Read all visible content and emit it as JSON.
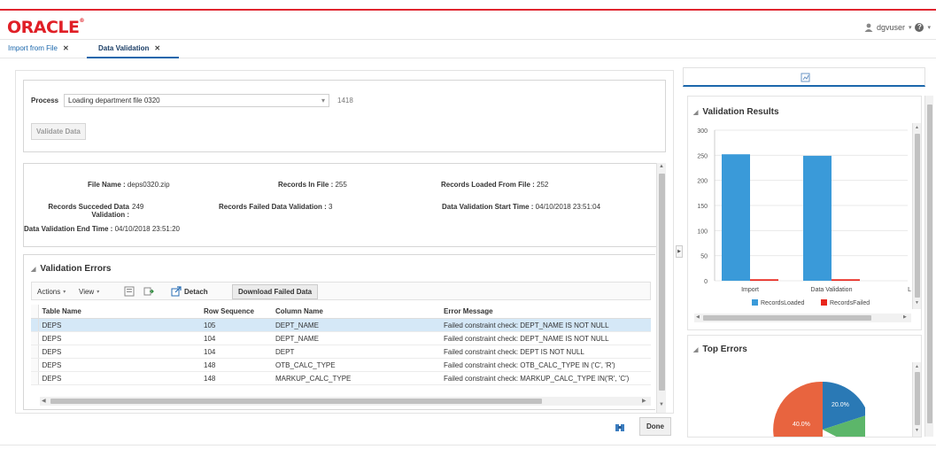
{
  "header": {
    "logo": "ORACLE",
    "user": "dgvuser",
    "help": "?"
  },
  "tabs": [
    {
      "label": "Import from File"
    },
    {
      "label": "Data Validation"
    }
  ],
  "process": {
    "label": "Process",
    "value": "Loading department file 0320",
    "id": "1418",
    "validate_button": "Validate Data"
  },
  "info": {
    "file_name_label": "File Name :",
    "file_name": "deps0320.zip",
    "records_in_file_label": "Records In File :",
    "records_in_file": "255",
    "records_loaded_label": "Records Loaded From File :",
    "records_loaded": "252",
    "succeeded_label_1": "Records Succeded Data",
    "succeeded_label_2": "Validation :",
    "succeeded": "249",
    "failed_label": "Records Failed Data Validation :",
    "failed": "3",
    "start_label": "Data Validation Start Time :",
    "start": "04/10/2018 23:51:04",
    "end_label": "Data Validation End Time :",
    "end": "04/10/2018 23:51:20"
  },
  "errors": {
    "title": "Validation Errors",
    "toolbar": {
      "actions": "Actions",
      "view": "View",
      "detach": "Detach",
      "download": "Download Failed Data"
    },
    "columns": [
      "Table Name",
      "Row Sequence",
      "Column Name",
      "Error Message"
    ],
    "rows": [
      [
        "DEPS",
        "105",
        "DEPT_NAME",
        "Failed constraint check: DEPT_NAME IS NOT NULL"
      ],
      [
        "DEPS",
        "104",
        "DEPT_NAME",
        "Failed constraint check: DEPT_NAME IS NOT NULL"
      ],
      [
        "DEPS",
        "104",
        "DEPT",
        "Failed constraint check: DEPT IS NOT NULL"
      ],
      [
        "DEPS",
        "148",
        "OTB_CALC_TYPE",
        "Failed constraint check: OTB_CALC_TYPE IN ('C', 'R')"
      ],
      [
        "DEPS",
        "148",
        "MARKUP_CALC_TYPE",
        "Failed constraint check: MARKUP_CALC_TYPE IN('R', 'C')"
      ]
    ]
  },
  "done_button": "Done",
  "colors": {
    "loaded": "#3a9ad9",
    "failed": "#e8261c",
    "pie_blue": "#2a79b5",
    "pie_red": "#e8643f",
    "pie_green": "#5cb66a",
    "accent": "#1b67ac"
  },
  "results": {
    "title": "Validation Results"
  },
  "top_errors": {
    "title": "Top Errors",
    "labels": [
      "20.0%",
      "40.0%"
    ]
  },
  "chart_data": {
    "type": "bar",
    "categories": [
      "Import",
      "Data Validation",
      "Loa"
    ],
    "series": [
      {
        "name": "RecordsLoaded",
        "values": [
          252,
          249,
          null
        ]
      },
      {
        "name": "RecordsFailed",
        "values": [
          3,
          3,
          null
        ]
      }
    ],
    "ylim": [
      0,
      300
    ],
    "yticks": [
      0,
      50,
      100,
      150,
      200,
      250,
      300
    ],
    "legend": "bottom"
  }
}
